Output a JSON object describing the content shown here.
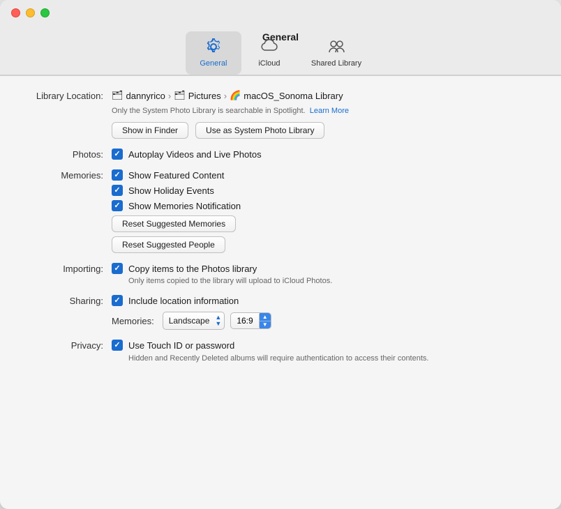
{
  "window": {
    "title": "General"
  },
  "toolbar": {
    "items": [
      {
        "id": "general",
        "label": "General",
        "active": true
      },
      {
        "id": "icloud",
        "label": "iCloud",
        "active": false
      },
      {
        "id": "shared-library",
        "label": "Shared Library",
        "active": false
      }
    ]
  },
  "library": {
    "location_label": "Library Location:",
    "path_parts": [
      "dannyrico",
      "Pictures",
      "macOS_Sonoma Library"
    ],
    "note": "Only the System Photo Library is searchable in Spotlight.",
    "learn_more": "Learn More",
    "show_in_finder": "Show in Finder",
    "use_as_system": "Use as System Photo Library"
  },
  "photos": {
    "label": "Photos:",
    "autoplay_label": "Autoplay Videos and Live Photos",
    "autoplay_checked": true
  },
  "memories": {
    "label": "Memories:",
    "featured_content_label": "Show Featured Content",
    "featured_content_checked": true,
    "holiday_events_label": "Show Holiday Events",
    "holiday_events_checked": true,
    "notification_label": "Show Memories Notification",
    "notification_checked": true,
    "reset_memories_btn": "Reset Suggested Memories",
    "reset_people_btn": "Reset Suggested People"
  },
  "importing": {
    "label": "Importing:",
    "copy_label": "Copy items to the Photos library",
    "copy_checked": true,
    "copy_note": "Only items copied to the library will upload to iCloud Photos."
  },
  "sharing": {
    "label": "Sharing:",
    "location_label": "Include location information",
    "location_checked": true,
    "memories_label": "Memories:",
    "landscape_value": "Landscape",
    "ratio_value": "16:9"
  },
  "privacy": {
    "label": "Privacy:",
    "touch_id_label": "Use Touch ID or password",
    "touch_id_checked": true,
    "touch_id_note": "Hidden and Recently Deleted albums will require authentication to access their contents."
  }
}
